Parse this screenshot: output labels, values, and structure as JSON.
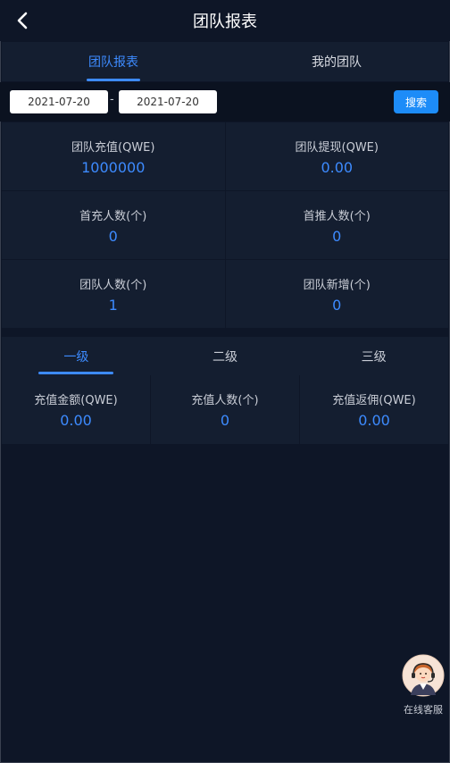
{
  "header": {
    "title": "团队报表",
    "back_icon": "chevron-left-icon"
  },
  "tabs": [
    {
      "label": "团队报表",
      "active": true
    },
    {
      "label": "我的团队",
      "active": false
    }
  ],
  "filter": {
    "start_date": "2021-07-20",
    "separator": "-",
    "end_date": "2021-07-20",
    "search_label": "搜索"
  },
  "stats": [
    {
      "label": "团队充值(QWE)",
      "value": "1000000"
    },
    {
      "label": "团队提现(QWE)",
      "value": "0.00"
    },
    {
      "label": "首充人数(个)",
      "value": "0"
    },
    {
      "label": "首推人数(个)",
      "value": "0"
    },
    {
      "label": "团队人数(个)",
      "value": "1"
    },
    {
      "label": "团队新增(个)",
      "value": "0"
    }
  ],
  "levels": {
    "tabs": [
      {
        "label": "一级",
        "active": true
      },
      {
        "label": "二级",
        "active": false
      },
      {
        "label": "三级",
        "active": false
      }
    ],
    "stats": [
      {
        "label": "充值金额(QWE)",
        "value": "0.00"
      },
      {
        "label": "充值人数(个)",
        "value": "0"
      },
      {
        "label": "充值返佣(QWE)",
        "value": "0.00"
      }
    ]
  },
  "customer_service": {
    "label": "在线客服",
    "icon": "support-agent-icon"
  },
  "colors": {
    "accent": "#3d8bff",
    "button": "#1d8cf8",
    "background": "#0e1627",
    "panel": "#141e30"
  }
}
